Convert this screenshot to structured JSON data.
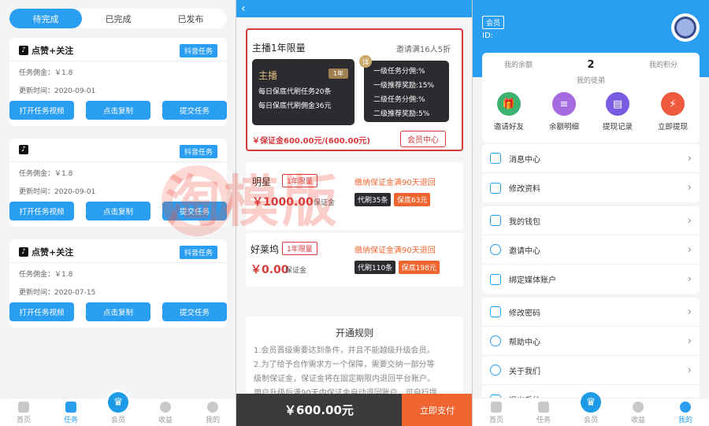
{
  "panel1": {
    "tabs": [
      "待完成",
      "已完成",
      "已发布"
    ],
    "cards": [
      {
        "title": "点赞+关注",
        "badge": "抖音任务",
        "commission": "任务佣金：￥1.8",
        "updated": "更新时间：2020-09-01"
      },
      {
        "title": "",
        "badge": "抖音任务",
        "commission": "任务佣金：￥1.8",
        "updated": "更新时间：2020-09-01"
      },
      {
        "title": "点赞+关注",
        "badge": "抖音任务",
        "commission": "任务佣金：￥1.8",
        "updated": "更新时间：2020-07-15"
      }
    ],
    "buttons": [
      "打开任务视频",
      "点击复制",
      "提交任务"
    ]
  },
  "tabbar_left": [
    "首页",
    "任务",
    "会员",
    "收益",
    "我的"
  ],
  "tabbar_right": [
    "首页",
    "任务",
    "会员",
    "收益",
    "我的"
  ],
  "panel2": {
    "plan1": {
      "title": "主播1年限量",
      "invite": "邀请满16人5折",
      "card_name": "主播",
      "card_year": "1年",
      "card_line1": "每日保底代刷任务20条",
      "card_line2": "每日保底代刷佣金36元",
      "detail_tag": "详",
      "detail": [
        "一级任务分佣:%",
        "一级推荐奖励:15%",
        "二级任务分佣:%",
        "二级推荐奖励:5%"
      ],
      "deposit": "￥保证金600.00元/(600.00元)",
      "center_btn": "会员中心"
    },
    "plan2": {
      "title": "明星",
      "tag": "1年限量",
      "price": "￥1000.00",
      "price_unit": "保证金",
      "note": "缴纳保证金满90天退回",
      "chip1": "代刷35条",
      "chip2": "保底63元"
    },
    "plan3": {
      "title": "好莱坞",
      "tag": "1年限量",
      "price": "￥0.00",
      "price_unit": "保证金",
      "note": "缴纳保证金满90天退回",
      "chip1": "代刷110条",
      "chip2": "保底198元"
    },
    "rules_title": "开通规则",
    "rules": [
      "1.会员晋级需要达到条件，并且不能越级升级会员。",
      "2.为了给予合作需求方一个保障，需要交纳一部分等",
      "级制保证金，保证金将在固定期限内退回平台账户。",
      "用户升级后满90天内保证金自动退回账户，可自行提"
    ],
    "pay_amount": "￥600.00元",
    "pay_btn": "立即支付",
    "back_icon": "‹"
  },
  "panel3": {
    "member_badge": "会员",
    "id_label": "ID:",
    "balance_label": "我的余额",
    "disciples_count": "2",
    "disciples_label": "我的徒弟",
    "points_label": "我的积分",
    "actions": [
      "邀请好友",
      "余额明细",
      "提现记录",
      "立即提现"
    ],
    "menu_groups": [
      [
        "消息中心",
        "修改资料"
      ],
      [
        "我的钱包",
        "邀请中心",
        "绑定媒体账户"
      ],
      [
        "修改密码",
        "帮助中心",
        "关于我们",
        "退出系统"
      ]
    ]
  },
  "watermark": "淘模版",
  "colors": {
    "primary": "#2a9ef0",
    "accent_red": "#d63a3a",
    "orange": "#f0652f"
  }
}
